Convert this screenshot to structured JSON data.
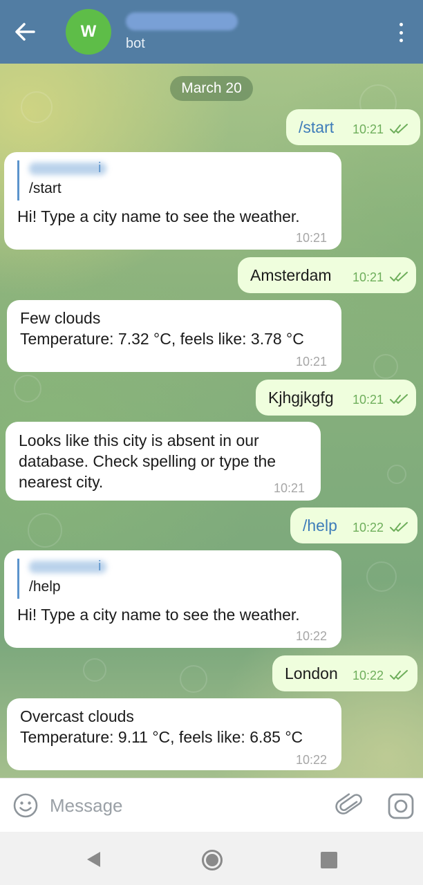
{
  "header": {
    "avatar_letter": "W",
    "status": "bot",
    "accent_color": "#527da3",
    "avatar_color": "#5ebd48"
  },
  "date_pill": "March 20",
  "messages": [
    {
      "dir": "out",
      "text": "/start",
      "time": "10:21"
    },
    {
      "dir": "in",
      "reply_name_end": "i",
      "reply_text": "/start",
      "text": "Hi! Type a city name to see the weather.",
      "time": "10:21"
    },
    {
      "dir": "out",
      "text": "Amsterdam",
      "time": "10:21"
    },
    {
      "dir": "in",
      "lines": [
        "Few clouds",
        "Temperature: 7.32 °C, feels like: 3.78 °C"
      ],
      "time": "10:21"
    },
    {
      "dir": "out",
      "text": "Kjhgjkgfg",
      "time": "10:21"
    },
    {
      "dir": "in",
      "lines": [
        "Looks like this city is absent in our",
        "database. Check spelling or type the",
        "nearest city."
      ],
      "time": "10:21"
    },
    {
      "dir": "out",
      "text": "/help",
      "time": "10:22"
    },
    {
      "dir": "in",
      "reply_name_end": "i",
      "reply_text": "/help",
      "text": "Hi! Type a city name to see the weather.",
      "time": "10:22"
    },
    {
      "dir": "out",
      "text": "London",
      "time": "10:22"
    },
    {
      "dir": "in",
      "lines": [
        "Overcast clouds",
        "Temperature: 9.11 °C, feels like: 6.85 °C"
      ],
      "time": "10:22"
    }
  ],
  "input": {
    "placeholder": "Message",
    "value": ""
  },
  "icons": {
    "back": "arrow-left-icon",
    "menu": "more-vertical-icon",
    "emoji": "smile-icon",
    "attach": "paperclip-icon",
    "camera": "camera-icon",
    "read": "double-check-icon",
    "nav_back": "triangle-back-icon",
    "nav_home": "circle-home-icon",
    "nav_recent": "square-recent-icon"
  }
}
